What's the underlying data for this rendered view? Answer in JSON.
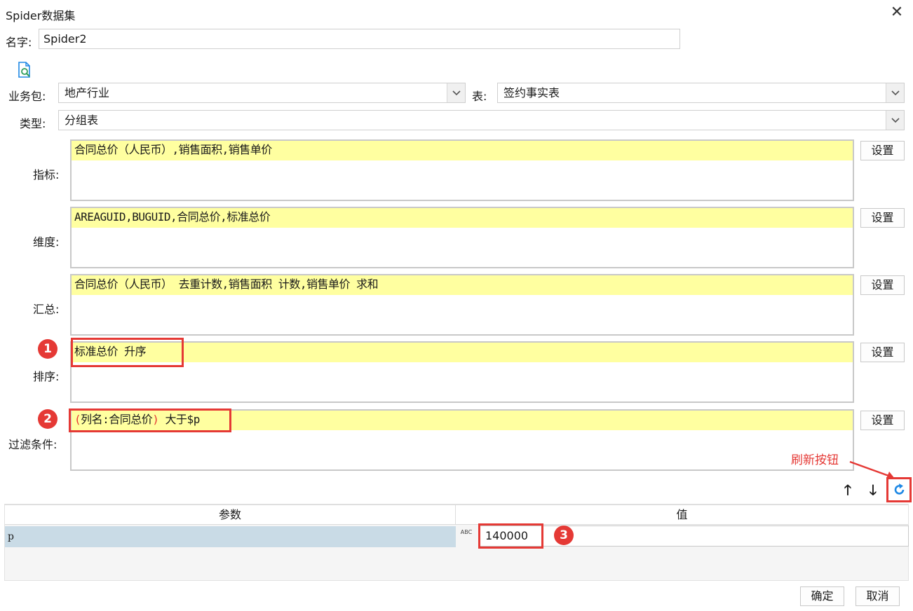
{
  "window": {
    "title": "Spider数据集"
  },
  "name": {
    "label": "名字:",
    "value": "Spider2"
  },
  "icons": {
    "preview": "document-search-icon",
    "close": "close-icon",
    "refresh": "refresh-icon",
    "up": "arrow-up-icon",
    "down": "arrow-down-icon",
    "type_switch": "type-switch-icon"
  },
  "business_pack": {
    "label": "业务包:",
    "value": "地产行业"
  },
  "table": {
    "label": "表:",
    "value": "签约事实表"
  },
  "type": {
    "label": "类型:",
    "value": "分组表"
  },
  "sections": [
    {
      "label": "指标:",
      "content": "合同总价（人民币）,销售面积,销售单价",
      "button": "设置"
    },
    {
      "label": "维度:",
      "content": "AREAGUID,BUGUID,合同总价,标准总价",
      "button": "设置"
    },
    {
      "label": "汇总:",
      "content": "合同总价（人民币） 去重计数,销售面积 计数,销售单价 求和",
      "button": "设置"
    },
    {
      "label": "排序:",
      "content": "标准总价 升序",
      "button": "设置"
    },
    {
      "label": "过滤条件:",
      "content_open": "(",
      "content_field": "列名:合同总价",
      "content_close": ")",
      "content_rest": " 大于$p",
      "button": "设置"
    }
  ],
  "annotations": {
    "badge1": "1",
    "badge2": "2",
    "badge3": "3",
    "refresh_label": "刷新按钮"
  },
  "params": {
    "headers": {
      "param": "参数",
      "value": "值"
    },
    "rows": [
      {
        "name": "p",
        "type_icon_text": "ABC",
        "value": "140000"
      }
    ]
  },
  "footer": {
    "ok": "确定",
    "cancel": "取消"
  },
  "colors": {
    "highlight": "#ffffa0",
    "annotation_red": "#e53935",
    "selected_row": "#c9dbe6",
    "icon_blue": "#1e88e5"
  }
}
